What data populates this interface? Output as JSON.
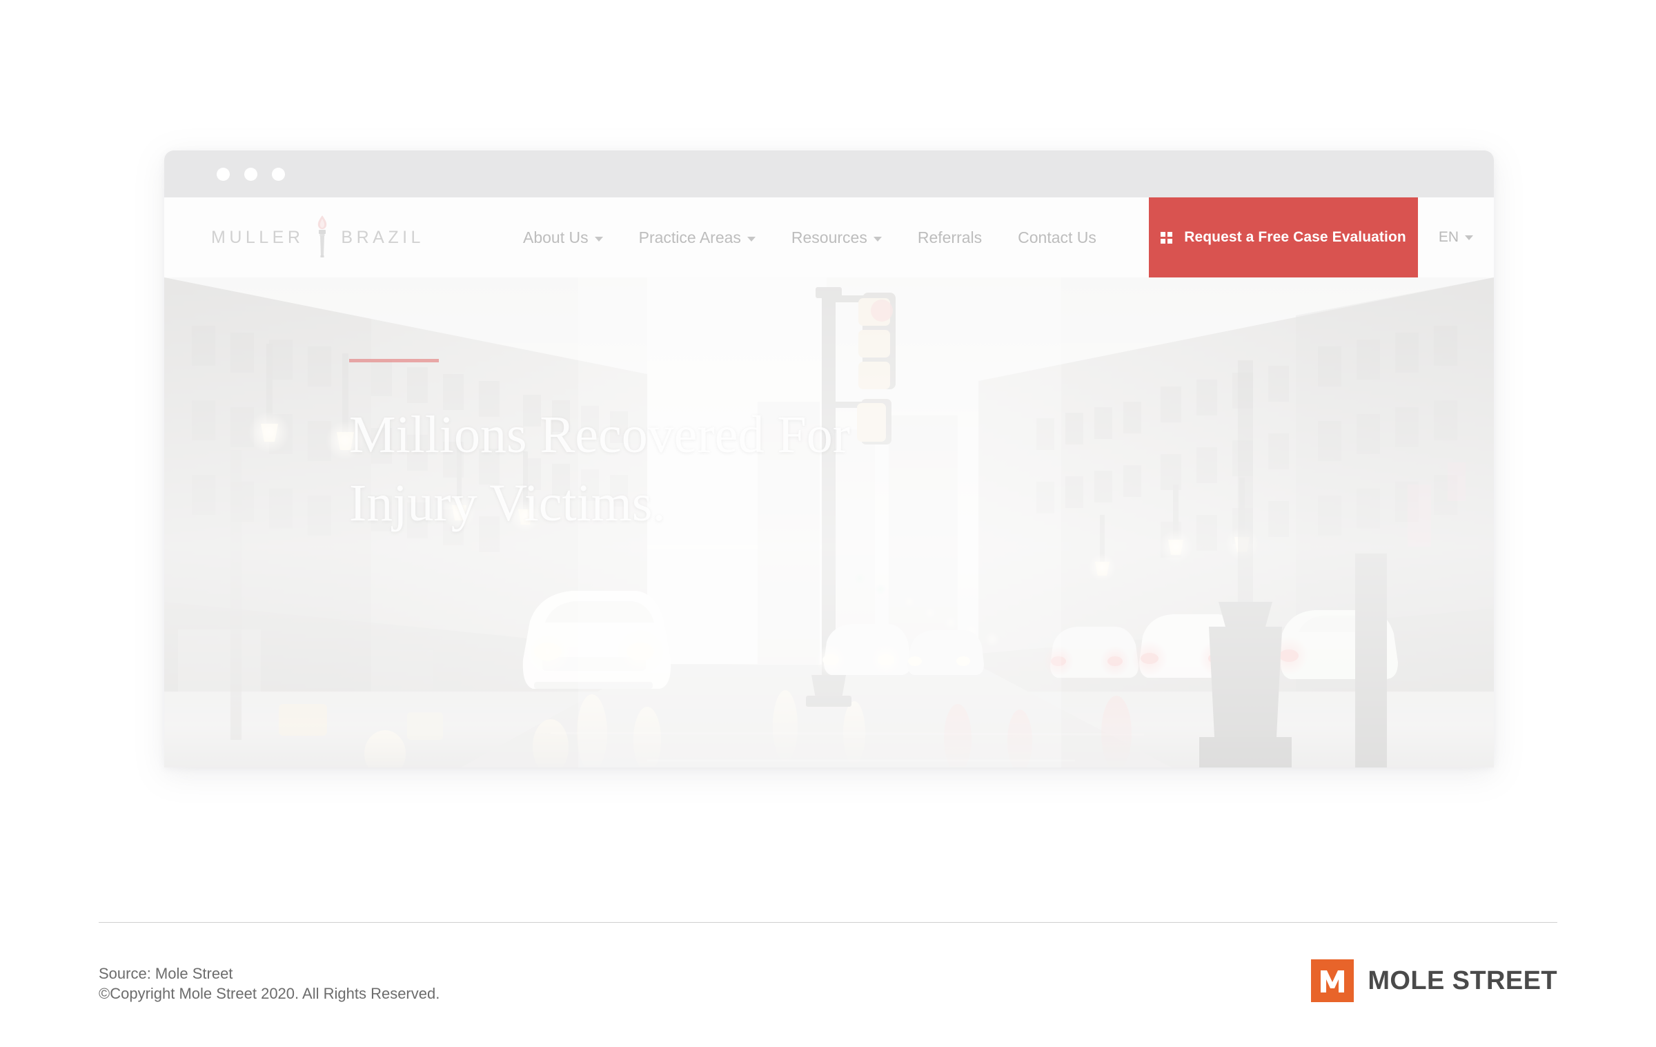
{
  "browser": {
    "dots": [
      "close-dot",
      "minimize-dot",
      "maximize-dot"
    ]
  },
  "site": {
    "logo": {
      "word_left": "MULLER",
      "word_right": "BRAZIL",
      "icon": "torch-icon"
    },
    "nav": {
      "items": [
        {
          "label": "About Us",
          "has_dropdown": true
        },
        {
          "label": "Practice Areas",
          "has_dropdown": true
        },
        {
          "label": "Resources",
          "has_dropdown": true
        },
        {
          "label": "Referrals",
          "has_dropdown": false
        },
        {
          "label": "Contact Us",
          "has_dropdown": false
        }
      ]
    },
    "cta": {
      "label": "Request a Free Case Evaluation",
      "icon": "grid-icon",
      "color": "#d95350"
    },
    "language": {
      "selected": "EN",
      "icon": "chevron-down-icon"
    }
  },
  "hero": {
    "headline": "Millions Recovered For\nInjury Victims.",
    "accent_color": "#e26c6c",
    "image_description": "rainy city street with traffic lights, streetlamps, cars and wet reflective pavement"
  },
  "footer": {
    "source_line": "Source: Mole Street",
    "copyright_line": "©Copyright Mole Street 2020. All Rights Reserved.",
    "brand": {
      "mark_letter": "M",
      "wordmark": "MOLE STREET",
      "mark_color": "#e8642a",
      "text_color": "#4a4a4a"
    }
  }
}
